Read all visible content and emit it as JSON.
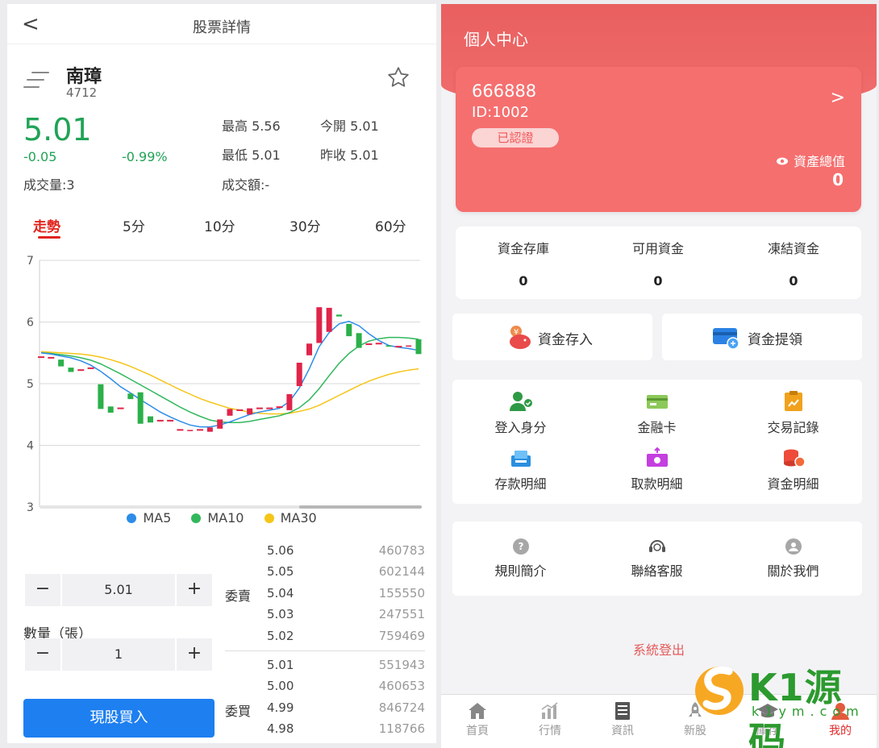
{
  "left": {
    "nav": {
      "back": "<",
      "title": "股票詳情"
    },
    "stock": {
      "name": "南璋",
      "code": "4712",
      "price": "5.01",
      "change": "-0.05",
      "change_pct": "-0.99%"
    },
    "quotes": {
      "high_label": "最高",
      "high": "5.56",
      "open_label": "今開",
      "open": "5.01",
      "low_label": "最低",
      "low": "5.01",
      "prev_label": "昨收",
      "prev": "5.01",
      "volume": "成交量:3",
      "amount": "成交額:-"
    },
    "tabs": [
      "走勢",
      "5分",
      "10分",
      "30分",
      "60分"
    ],
    "legend": [
      {
        "name": "MA5",
        "color": "#2d8ce8"
      },
      {
        "name": "MA10",
        "color": "#31b85c"
      },
      {
        "name": "MA30",
        "color": "#f5c518"
      }
    ],
    "price_stepper": {
      "minus": "−",
      "value": "5.01",
      "plus": "+"
    },
    "qty_label": "數量（張）",
    "qty_stepper": {
      "minus": "−",
      "value": "1",
      "plus": "+"
    },
    "buy_button": "現股買入",
    "book": {
      "ask_label": "委賣",
      "bid_label": "委買",
      "asks": [
        {
          "price": "5.06",
          "vol": "460783"
        },
        {
          "price": "5.05",
          "vol": "602144"
        },
        {
          "price": "5.04",
          "vol": "155550"
        },
        {
          "price": "5.03",
          "vol": "247551"
        },
        {
          "price": "5.02",
          "vol": "759469"
        }
      ],
      "bids": [
        {
          "price": "5.01",
          "vol": "551943"
        },
        {
          "price": "5.00",
          "vol": "460653"
        },
        {
          "price": "4.99",
          "vol": "846724"
        },
        {
          "price": "4.98",
          "vol": "118766"
        }
      ]
    }
  },
  "chart_data": {
    "type": "candlestick",
    "ylim": [
      3,
      7
    ],
    "y_ticks": [
      "3",
      "4",
      "5",
      "6",
      "7"
    ],
    "candles": [
      {
        "o": 5.43,
        "c": 5.43
      },
      {
        "o": 5.42,
        "c": 5.42
      },
      {
        "o": 5.39,
        "c": 5.28
      },
      {
        "o": 5.26,
        "c": 5.19
      },
      {
        "o": 5.22,
        "c": 5.22
      },
      {
        "o": 5.25,
        "c": 5.25
      },
      {
        "o": 4.99,
        "c": 4.59
      },
      {
        "o": 4.63,
        "c": 4.53
      },
      {
        "o": 4.6,
        "c": 4.6
      },
      {
        "o": 4.84,
        "c": 4.75
      },
      {
        "o": 4.86,
        "c": 4.35
      },
      {
        "o": 4.47,
        "c": 4.37
      },
      {
        "o": 4.4,
        "c": 4.4
      },
      {
        "o": 4.4,
        "c": 4.4
      },
      {
        "o": 4.25,
        "c": 4.25
      },
      {
        "o": 4.23,
        "c": 4.25
      },
      {
        "o": 4.25,
        "c": 4.25
      },
      {
        "o": 4.22,
        "c": 4.29
      },
      {
        "o": 4.27,
        "c": 4.42
      },
      {
        "o": 4.48,
        "c": 4.59
      },
      {
        "o": 4.57,
        "c": 4.57
      },
      {
        "o": 4.5,
        "c": 4.6
      },
      {
        "o": 4.6,
        "c": 4.6
      },
      {
        "o": 4.6,
        "c": 4.6
      },
      {
        "o": 4.62,
        "c": 4.62
      },
      {
        "o": 4.57,
        "c": 4.83
      },
      {
        "o": 4.96,
        "c": 5.34
      },
      {
        "o": 5.46,
        "c": 5.65
      },
      {
        "o": 5.66,
        "c": 6.24
      },
      {
        "o": 5.84,
        "c": 6.23
      },
      {
        "o": 6.12,
        "c": 6.09
      },
      {
        "o": 5.97,
        "c": 5.77
      },
      {
        "o": 5.82,
        "c": 5.58
      },
      {
        "o": 5.64,
        "c": 5.64
      },
      {
        "o": 5.65,
        "c": 5.65
      },
      {
        "o": 5.62,
        "c": 5.6
      },
      {
        "o": 5.6,
        "c": 5.6
      },
      {
        "o": 5.6,
        "c": 5.62
      },
      {
        "o": 5.72,
        "c": 5.48
      }
    ],
    "ma5": [
      5.5,
      5.48,
      5.45,
      5.42,
      5.37,
      5.3,
      5.2,
      5.08,
      4.95,
      4.85,
      4.74,
      4.64,
      4.54,
      4.46,
      4.39,
      4.33,
      4.3,
      4.3,
      4.33,
      4.38,
      4.44,
      4.5,
      4.54,
      4.57,
      4.6,
      4.71,
      4.93,
      5.24,
      5.6,
      5.83,
      5.97,
      6.01,
      5.94,
      5.81,
      5.7,
      5.62,
      5.59,
      5.57,
      5.54
    ],
    "ma10": [
      5.5,
      5.49,
      5.47,
      5.45,
      5.42,
      5.38,
      5.32,
      5.24,
      5.16,
      5.07,
      4.98,
      4.89,
      4.8,
      4.71,
      4.62,
      4.54,
      4.47,
      4.41,
      4.38,
      4.37,
      4.37,
      4.39,
      4.42,
      4.45,
      4.48,
      4.53,
      4.61,
      4.74,
      4.92,
      5.13,
      5.33,
      5.49,
      5.61,
      5.69,
      5.73,
      5.75,
      5.75,
      5.74,
      5.72
    ],
    "ma30": [
      5.52,
      5.51,
      5.5,
      5.49,
      5.48,
      5.46,
      5.43,
      5.39,
      5.34,
      5.28,
      5.21,
      5.14,
      5.06,
      4.98,
      4.9,
      4.83,
      4.76,
      4.7,
      4.65,
      4.6,
      4.57,
      4.54,
      4.52,
      4.51,
      4.51,
      4.52,
      4.55,
      4.59,
      4.65,
      4.73,
      4.81,
      4.89,
      4.97,
      5.04,
      5.1,
      5.15,
      5.19,
      5.22,
      5.24
    ]
  },
  "right": {
    "header_title": "個人中心",
    "card": {
      "username": "666888",
      "id": "ID:1002",
      "badge": "已認證",
      "arrow": ">",
      "assets_label": "資產總值",
      "assets_value": "0"
    },
    "funds": [
      {
        "label": "資金存庫",
        "value": "0"
      },
      {
        "label": "可用資金",
        "value": "0"
      },
      {
        "label": "凍結資金",
        "value": "0"
      }
    ],
    "actions": [
      {
        "label": "資金存入",
        "icon": "deposit-piggy-icon"
      },
      {
        "label": "資金提領",
        "icon": "withdraw-card-icon"
      }
    ],
    "grid1": [
      {
        "label": "登入身分",
        "icon": "user-verify-icon"
      },
      {
        "label": "金融卡",
        "icon": "bank-card-icon"
      },
      {
        "label": "交易記錄",
        "icon": "trade-record-icon"
      },
      {
        "label": "存款明細",
        "icon": "deposit-detail-icon"
      },
      {
        "label": "取款明細",
        "icon": "withdraw-detail-icon"
      },
      {
        "label": "資金明細",
        "icon": "fund-detail-icon"
      }
    ],
    "grid2": [
      {
        "label": "規則簡介",
        "icon": "rules-icon"
      },
      {
        "label": "聯絡客服",
        "icon": "support-icon"
      },
      {
        "label": "關於我們",
        "icon": "about-icon"
      }
    ],
    "logout": "系統登出",
    "tabbar": [
      {
        "label": "首頁",
        "icon": "home-icon"
      },
      {
        "label": "行情",
        "icon": "market-icon"
      },
      {
        "label": "資訊",
        "icon": "news-icon"
      },
      {
        "label": "新股",
        "icon": "rocket-icon"
      },
      {
        "label": "庫存",
        "icon": "stock-icon"
      },
      {
        "label": "我的",
        "icon": "profile-icon"
      }
    ]
  },
  "watermark": {
    "brand": "K1源码",
    "site": "k1ym.com"
  }
}
